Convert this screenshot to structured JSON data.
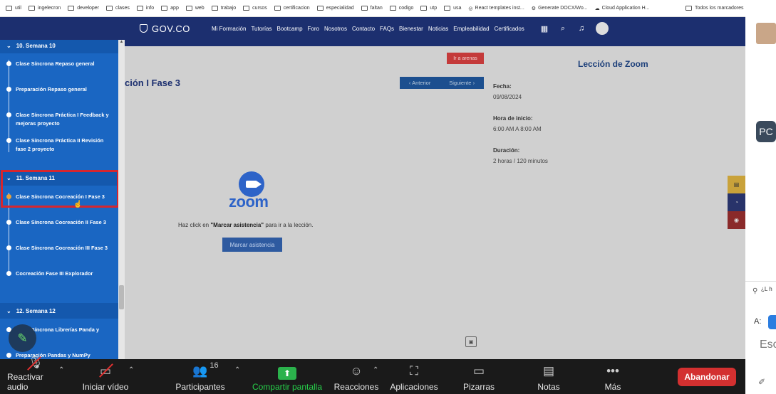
{
  "bookmarks": {
    "items": [
      "util",
      "ingelecron",
      "developer",
      "clases",
      "info",
      "app",
      "web",
      "trabajo",
      "cursos",
      "certificacion",
      "especialidad",
      "faltan",
      "codigo",
      "utp",
      "usa",
      "React templates inst...",
      "Generate DOCX/Wo...",
      "Cloud Application H..."
    ],
    "right": "Todos los marcadores"
  },
  "gov": {
    "logo": "GOV.CO",
    "nav": [
      "Mi Formación",
      "Tutorías",
      "Bootcamp",
      "Foro",
      "Nosotros",
      "Contacto",
      "FAQs",
      "Bienestar",
      "Noticias",
      "Empleabilidad",
      "Certificados"
    ]
  },
  "sidebar": {
    "week10": "10. Semana 10",
    "week11": "11. Semana 11",
    "week12": "12. Semana 12",
    "lessons10": [
      "Clase Síncrona Repaso general",
      "Preparación Repaso general",
      "Clase Síncrona Práctica I Feedback y mejoras proyecto",
      "Clase Síncrona Práctica II Revisión fase 2 proyecto"
    ],
    "lessons11": [
      "Clase Síncrona Cocreación I Fase 3",
      "Clase Síncrona Cocreación II Fase 3",
      "Clase Síncrona Cocreación III Fase 3",
      "Cocreación Fase III Explorador"
    ],
    "lessons12": [
      "Clase Síncrona Librerías Panda y NumPy",
      "Preparación Pandas y NumPy"
    ]
  },
  "main": {
    "title_partial": "ción I Fase 3",
    "arenas": "Ir a arenas",
    "prev": "Anterior",
    "next": "Siguiente",
    "zoom_word": "zoom",
    "hint_pre": "Haz click en ",
    "hint_bold": "\"Marcar asistencia\"",
    "hint_post": " para ir a la lección.",
    "marcar": "Marcar asistencia",
    "lesson_title": "Lección de Zoom",
    "fecha_label": "Fecha:",
    "fecha_value": "09/08/2024",
    "hora_label": "Hora de inicio:",
    "hora_value": "6:00 AM A 8:00 AM",
    "duracion_label": "Duración:",
    "duracion_value": "2 horas / 120 minutos"
  },
  "rightpanel": {
    "pc": "PC",
    "small": "¿L h",
    "a_label": "A:",
    "esc": "Esc"
  },
  "zoombar": {
    "audio": "Reactivar audio",
    "video": "Iniciar vídeo",
    "participants": "Participantes",
    "participants_count": "16",
    "share": "Compartir pantalla",
    "reactions": "Reacciones",
    "apps": "Aplicaciones",
    "whiteboards": "Pizarras",
    "notes": "Notas",
    "more": "Más",
    "leave": "Abandonar"
  },
  "colors": {
    "gov_blue": "#1c2f6f",
    "sidebar_blue": "#1a66c2",
    "highlight": "#d6262e",
    "zoom_blue": "#2d63c8",
    "leave_red": "#d33030",
    "share_green": "#2bb24c"
  }
}
